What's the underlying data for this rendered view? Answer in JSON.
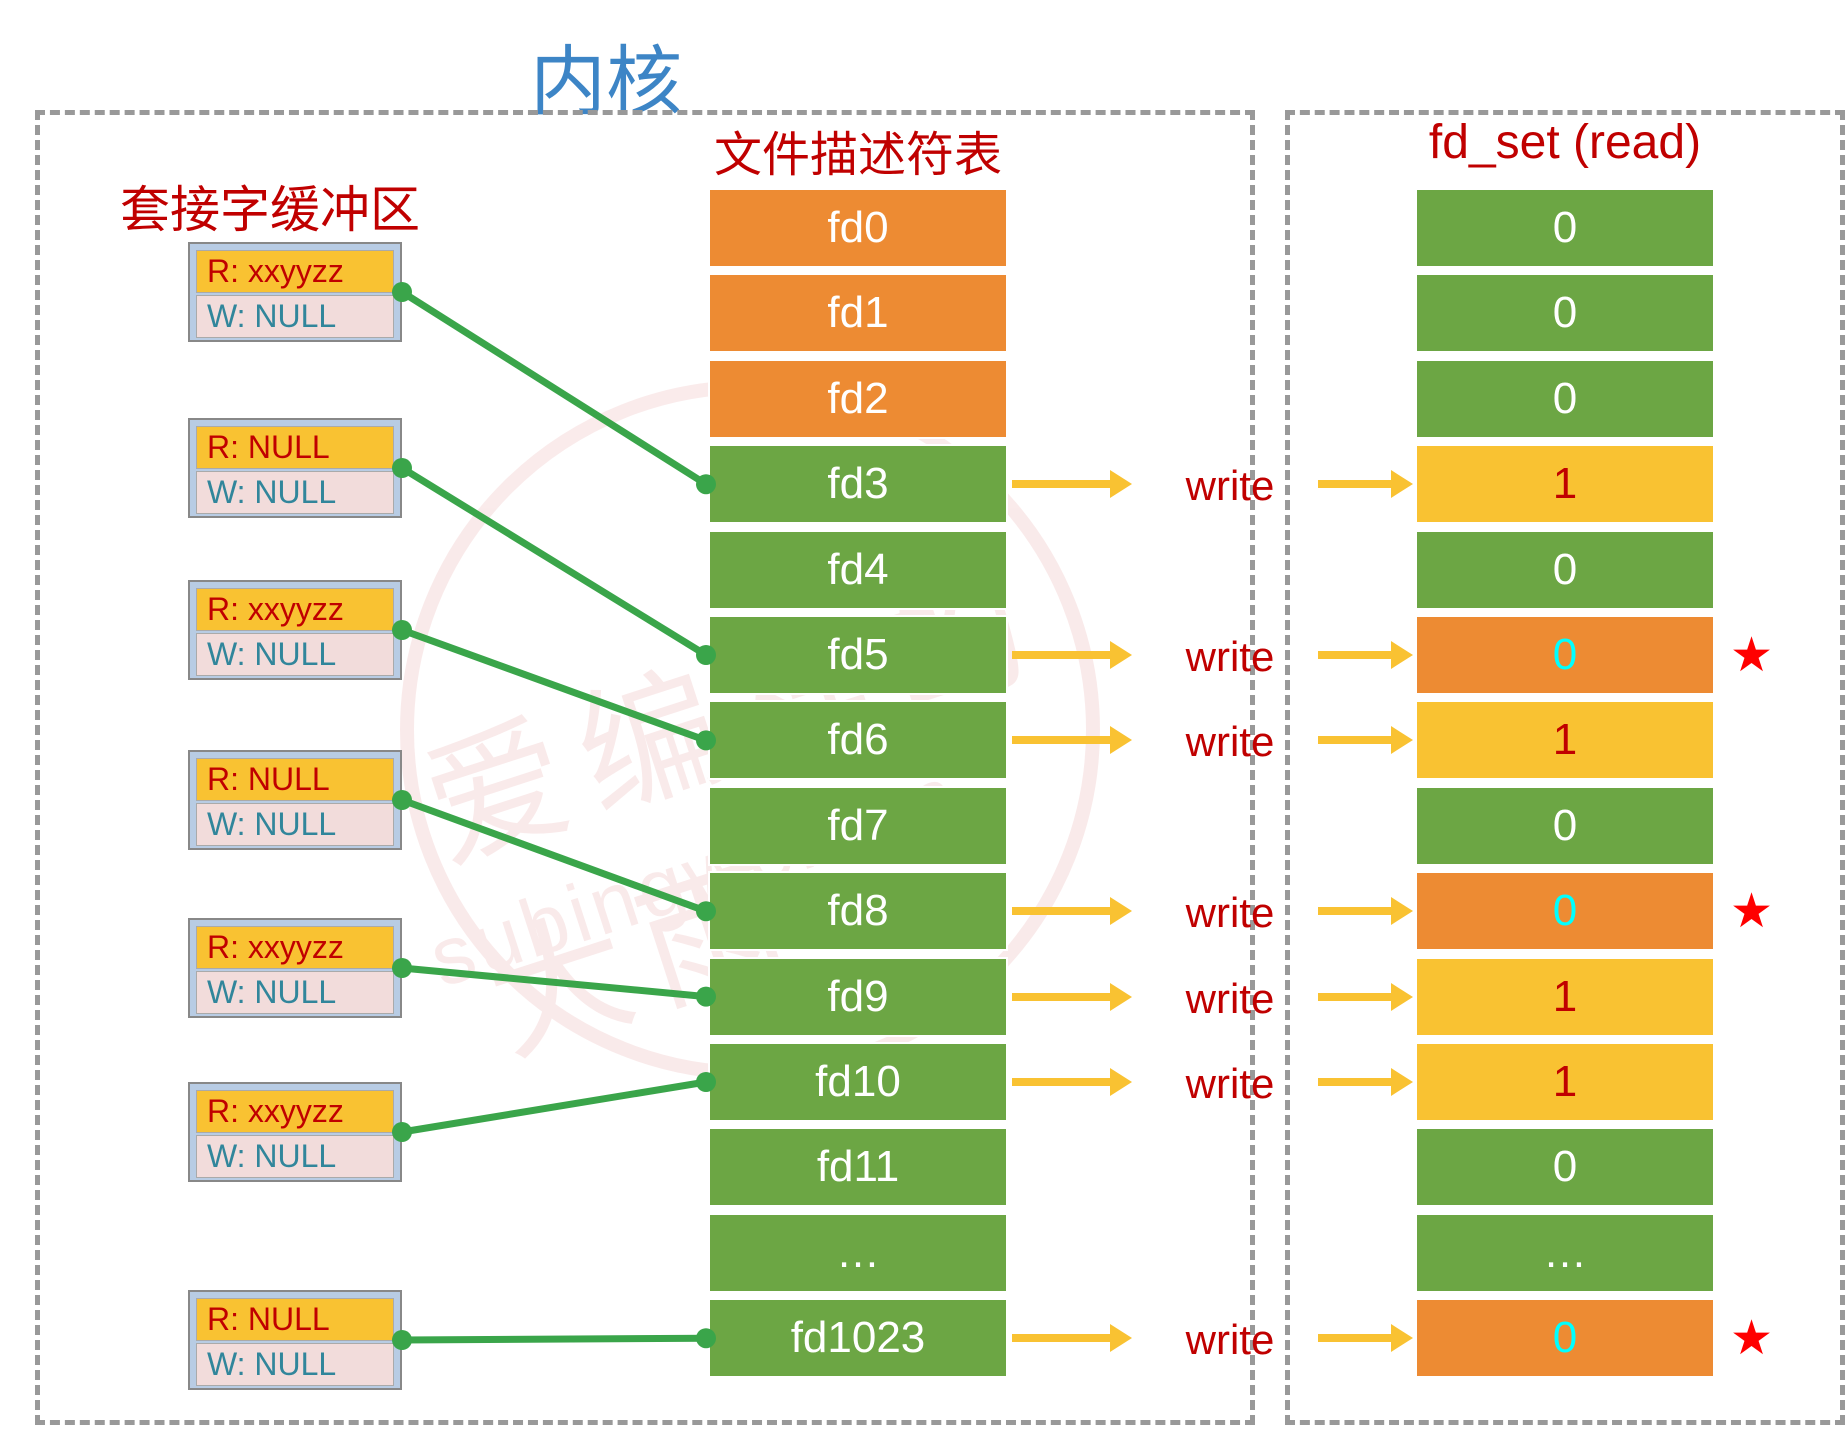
{
  "labels": {
    "kernel": "内核",
    "socket_buffer": "套接字缓冲区",
    "fd_table": "文件描述符表",
    "fd_set": "fd_set (read)",
    "write": "write"
  },
  "watermark": {
    "line1": "爱编程的大雨",
    "line2": "subingwen.cn"
  },
  "chart_data": {
    "type": "diagram",
    "buffers": [
      {
        "r": "R: xxyyzz",
        "w": "W: NULL",
        "connect_to": "fd3"
      },
      {
        "r": "R: NULL",
        "w": "W: NULL",
        "connect_to": "fd5"
      },
      {
        "r": "R: xxyyzz",
        "w": "W: NULL",
        "connect_to": "fd6"
      },
      {
        "r": "R: NULL",
        "w": "W: NULL",
        "connect_to": "fd8"
      },
      {
        "r": "R: xxyyzz",
        "w": "W: NULL",
        "connect_to": "fd9"
      },
      {
        "r": "R: xxyyzz",
        "w": "W: NULL",
        "connect_to": "fd10"
      },
      {
        "r": "R: NULL",
        "w": "W: NULL",
        "connect_to": "fd1023"
      }
    ],
    "fd_table": [
      {
        "name": "fd0",
        "color": "orange"
      },
      {
        "name": "fd1",
        "color": "orange"
      },
      {
        "name": "fd2",
        "color": "orange"
      },
      {
        "name": "fd3",
        "color": "green"
      },
      {
        "name": "fd4",
        "color": "green"
      },
      {
        "name": "fd5",
        "color": "green"
      },
      {
        "name": "fd6",
        "color": "green"
      },
      {
        "name": "fd7",
        "color": "green"
      },
      {
        "name": "fd8",
        "color": "green"
      },
      {
        "name": "fd9",
        "color": "green"
      },
      {
        "name": "fd10",
        "color": "green"
      },
      {
        "name": "fd11",
        "color": "green"
      },
      {
        "name": "…",
        "color": "green"
      },
      {
        "name": "fd1023",
        "color": "green"
      }
    ],
    "fd_set": [
      {
        "value": "0",
        "style": "green",
        "write_arrow": false,
        "star": false
      },
      {
        "value": "0",
        "style": "green",
        "write_arrow": false,
        "star": false
      },
      {
        "value": "0",
        "style": "green",
        "write_arrow": false,
        "star": false
      },
      {
        "value": "1",
        "style": "yellow",
        "write_arrow": true,
        "star": false
      },
      {
        "value": "0",
        "style": "green",
        "write_arrow": false,
        "star": false
      },
      {
        "value": "0",
        "style": "orange",
        "write_arrow": true,
        "star": true
      },
      {
        "value": "1",
        "style": "yellow",
        "write_arrow": true,
        "star": false
      },
      {
        "value": "0",
        "style": "green",
        "write_arrow": false,
        "star": false
      },
      {
        "value": "0",
        "style": "orange",
        "write_arrow": true,
        "star": true
      },
      {
        "value": "1",
        "style": "yellow",
        "write_arrow": true,
        "star": false
      },
      {
        "value": "1",
        "style": "yellow",
        "write_arrow": true,
        "star": false
      },
      {
        "value": "0",
        "style": "green",
        "write_arrow": false,
        "star": false
      },
      {
        "value": "…",
        "style": "green",
        "write_arrow": false,
        "star": false
      },
      {
        "value": "0",
        "style": "orange",
        "write_arrow": true,
        "star": true
      }
    ]
  }
}
